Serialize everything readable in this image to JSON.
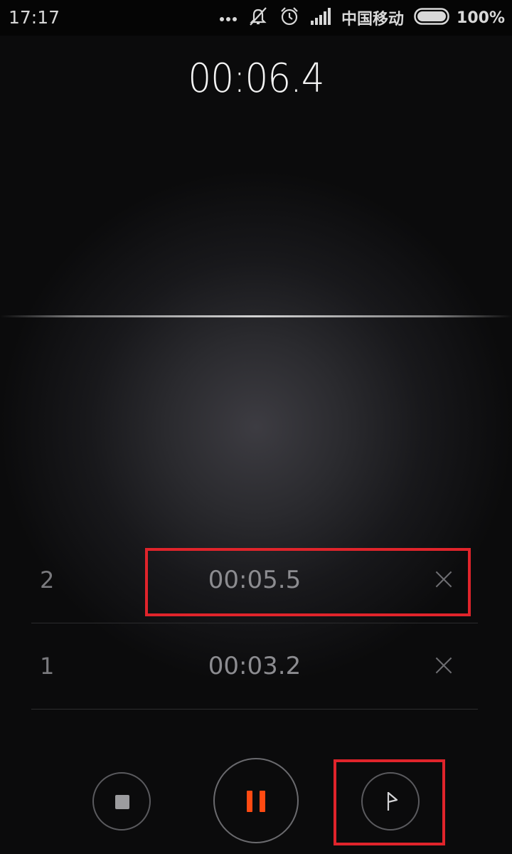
{
  "status_bar": {
    "time": "17:17",
    "carrier": "中国移动",
    "battery": "100%",
    "icons": [
      "more-dots-icon",
      "mute-icon",
      "alarm-icon",
      "signal-icon",
      "battery-icon"
    ]
  },
  "stopwatch": {
    "elapsed": "00:06.4"
  },
  "laps": [
    {
      "number": "2",
      "time": "00:05.5"
    },
    {
      "number": "1",
      "time": "00:03.2"
    }
  ],
  "controls": {
    "stop_icon": "stop-icon",
    "pause_icon": "pause-icon",
    "lap_icon": "flag-icon"
  },
  "colors": {
    "accent": "#ff4a12",
    "highlight": "#e0242b"
  }
}
